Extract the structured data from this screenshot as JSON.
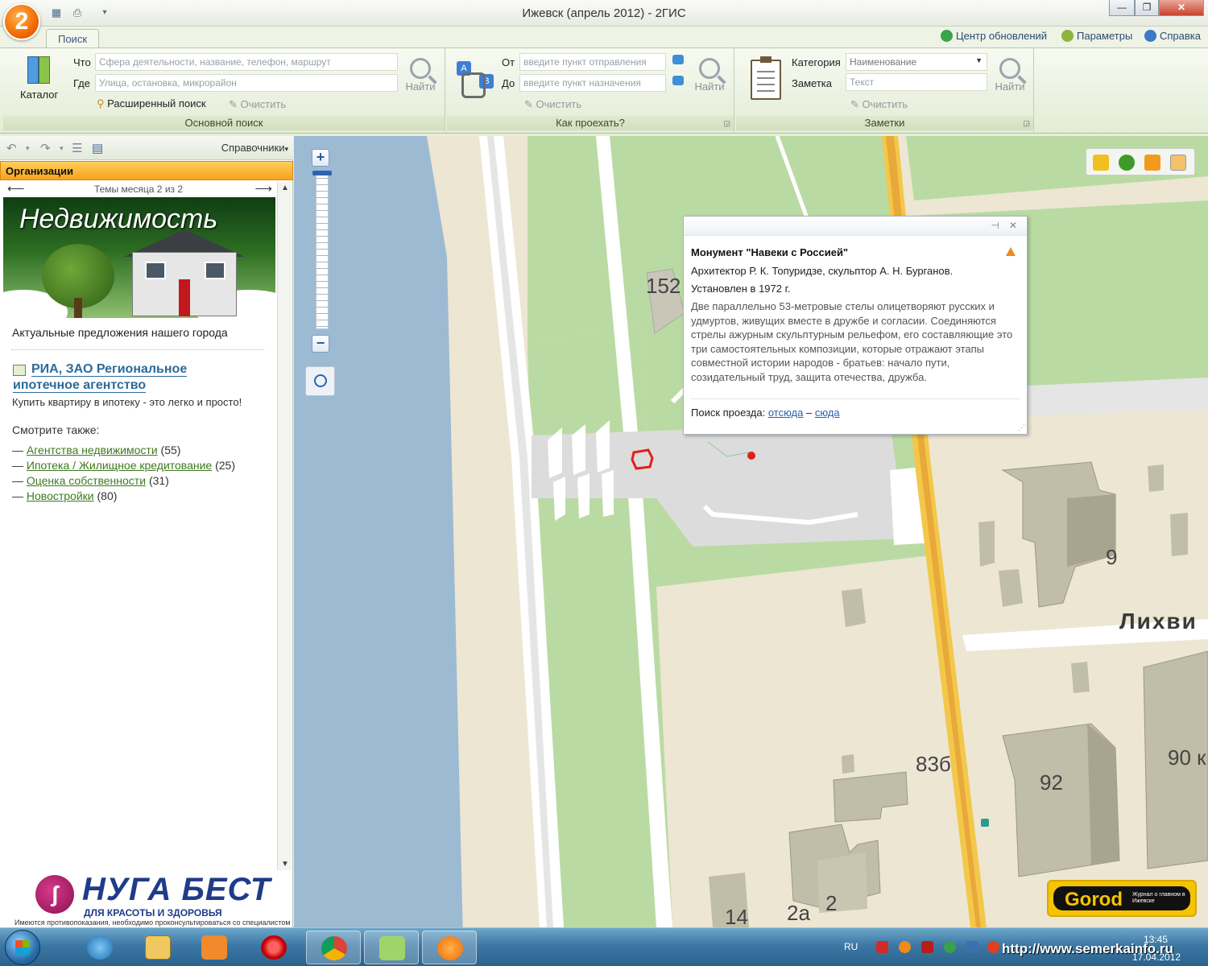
{
  "window": {
    "title": "Ижевск (апрель 2012) - 2ГИС",
    "app_logo": "2"
  },
  "ribbon": {
    "tab_label": "Поиск",
    "top_links": [
      "Центр обновлений",
      "Параметры",
      "Справка"
    ],
    "catalog_label": "Каталог",
    "main_search": {
      "what_label": "Что",
      "what_placeholder": "Сфера деятельности, название, телефон, маршрут",
      "where_label": "Где",
      "where_placeholder": "Улица, остановка, микрорайон",
      "advanced_label": "Расширенный поиск",
      "clear_label": "Очистить",
      "find_label": "Найти",
      "group_label": "Основной поиск"
    },
    "route": {
      "from_label": "От",
      "from_placeholder": "введите пункт отправления",
      "to_label": "До",
      "to_placeholder": "введите пункт назначения",
      "clear_label": "Очистить",
      "find_label": "Найти",
      "group_label": "Как проехать?"
    },
    "notes": {
      "category_label": "Категория",
      "category_value": "Наименование",
      "note_label": "Заметка",
      "note_placeholder": "Текст",
      "clear_label": "Очистить",
      "find_label": "Найти",
      "group_label": "Заметки"
    }
  },
  "left_panel": {
    "directories_label": "Справочники",
    "orgs_header": "Организации",
    "themes_label": "Темы месяца 2 из 2",
    "banner_title": "Недвижимость",
    "offer_text": "Актуальные предложения нашего города",
    "org_name": "РИА, ЗАО Региональное ипотечное агентство",
    "org_desc": "Купить квартиру в ипотеку - это легко и просто!",
    "see_also_label": "Смотрите также:",
    "see_also": [
      {
        "label": "Агентства недвижимости",
        "count": "(55)"
      },
      {
        "label": "Ипотека / Жилищное кредитование",
        "count": "(25)"
      },
      {
        "label": "Оценка собственности",
        "count": "(31)"
      },
      {
        "label": "Новостройки",
        "count": "(80)"
      }
    ],
    "ad": {
      "name": "НУГА БЕСТ",
      "subtitle": "ДЛЯ КРАСОТЫ И ЗДОРОВЬЯ",
      "warning": "Имеются противопоказания, необходимо проконсультироваться со специалистом"
    }
  },
  "map": {
    "building_numbers": [
      "152",
      "9",
      "83б",
      "92",
      "90 к",
      "14",
      "2а",
      "2"
    ],
    "street_label": "Лихви",
    "gorod_logo": "Gorod",
    "gorod_tagline": "Журнал о главном в Ижевске"
  },
  "popup": {
    "title": "Монумент \"Навеки с Россией\"",
    "authors": "Архитектор Р. К. Топуридзе, скульптор А. Н. Бурганов.",
    "year": "Установлен в 1972 г.",
    "description": "Две параллельно 53-метровые стелы олицетворяют русских и удмуртов, живущих вместе в дружбе и согласии. Соединяются стрелы ажурным скульптурным рельефом, его составляющие это три самостоятельных композиции, которые отражают этапы совместной истории народов - братьев: начало пути, созидательный труд, защита отечества, дружба.",
    "route_label": "Поиск проезда:",
    "route_from": "отсюда",
    "route_dash": "–",
    "route_to": "сюда"
  },
  "taskbar": {
    "language": "RU",
    "url_overlay": "http://www.semerkainfo.ru",
    "time": "13:45",
    "date": "17.04.2012"
  },
  "colors": {
    "accent_orange": "#f4a31e",
    "link_green": "#3d7a1f",
    "link_blue": "#2b5fb0",
    "road_yellow": "#f3c84a",
    "river_blue": "#9dbad3"
  }
}
